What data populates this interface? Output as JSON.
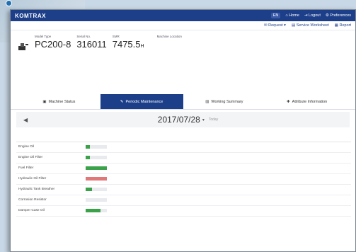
{
  "app": {
    "logo": "KOMTRAX"
  },
  "topbar": {
    "language": "EN",
    "links": [
      "Home",
      "Logout",
      "Preferences"
    ]
  },
  "subbar": {
    "links": [
      "Request",
      "Service Worksheet",
      "Report"
    ]
  },
  "machine": {
    "model_label": "Model Type",
    "model": "PC200-8",
    "serial_label": "Serial No.",
    "serial": "316011",
    "smr_label": "SMR",
    "smr": "7475.5",
    "smr_unit": "H",
    "location_label": "Machine Location"
  },
  "tabs": [
    {
      "label": "Machine Status",
      "icon": "car-icon",
      "active": false
    },
    {
      "label": "Periodic Maintenance",
      "icon": "wrench-icon",
      "active": true
    },
    {
      "label": "Working Summary",
      "icon": "chart-icon",
      "active": false
    },
    {
      "label": "Attribute Information",
      "icon": "tag-icon",
      "active": false
    }
  ],
  "date_bar": {
    "date": "2017/07/28",
    "caret": "▾",
    "today": "Today",
    "prev": "◀"
  },
  "table": {
    "rows": [
      {
        "name": "Engine Oil",
        "pct": 0.2,
        "color": "#3aa34a"
      },
      {
        "name": "Engine Oil Filter",
        "pct": 0.2,
        "color": "#3aa34a"
      },
      {
        "name": "Fuel Filter",
        "pct": 1.0,
        "color": "#3aa34a"
      },
      {
        "name": "Hydraulic Oil Filter",
        "pct": 1.0,
        "color": "#e0787a"
      },
      {
        "name": "Hydraulic Tank Breather",
        "pct": 0.3,
        "color": "#3aa34a"
      },
      {
        "name": "Corrosion Resistor",
        "pct": 0,
        "color": "#3aa34a"
      },
      {
        "name": "Damper Case Oil",
        "pct": 0.7,
        "color": "#3aa34a"
      }
    ]
  }
}
